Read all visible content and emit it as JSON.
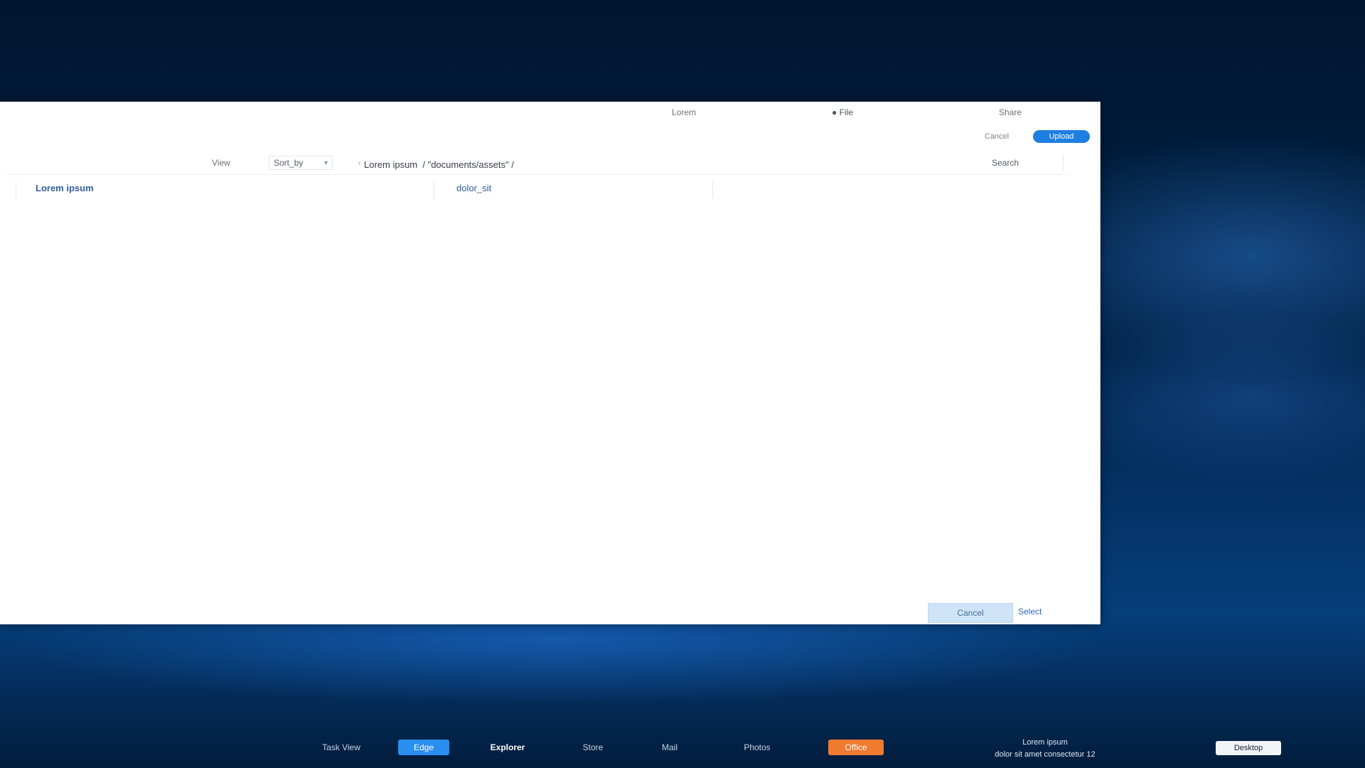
{
  "window": {
    "titlebar_items": [
      "Lorem",
      "● File",
      "Share"
    ],
    "secondary_action": "Cancel",
    "primary_action": "Upload"
  },
  "toolbar": {
    "view_label": "View",
    "sort_label": "Sort_by",
    "path_value": "Lorem ipsum  / \"documents/assets\" /",
    "search_label": "Search",
    "back_icon": "chevron-down-icon"
  },
  "columns": {
    "first": "Lorem ipsum",
    "second": "dolor_sit"
  },
  "footer": {
    "secondary_button": "Cancel",
    "primary_link": "Select"
  },
  "taskbar": {
    "apps": [
      "Task View",
      "Edge",
      "Explorer",
      "Store",
      "Mail",
      "Photos",
      "Office"
    ],
    "tray_line1": "Lorem ipsum",
    "tray_line2": "dolor sit amet consectetur 12",
    "tray_button": "Desktop"
  }
}
